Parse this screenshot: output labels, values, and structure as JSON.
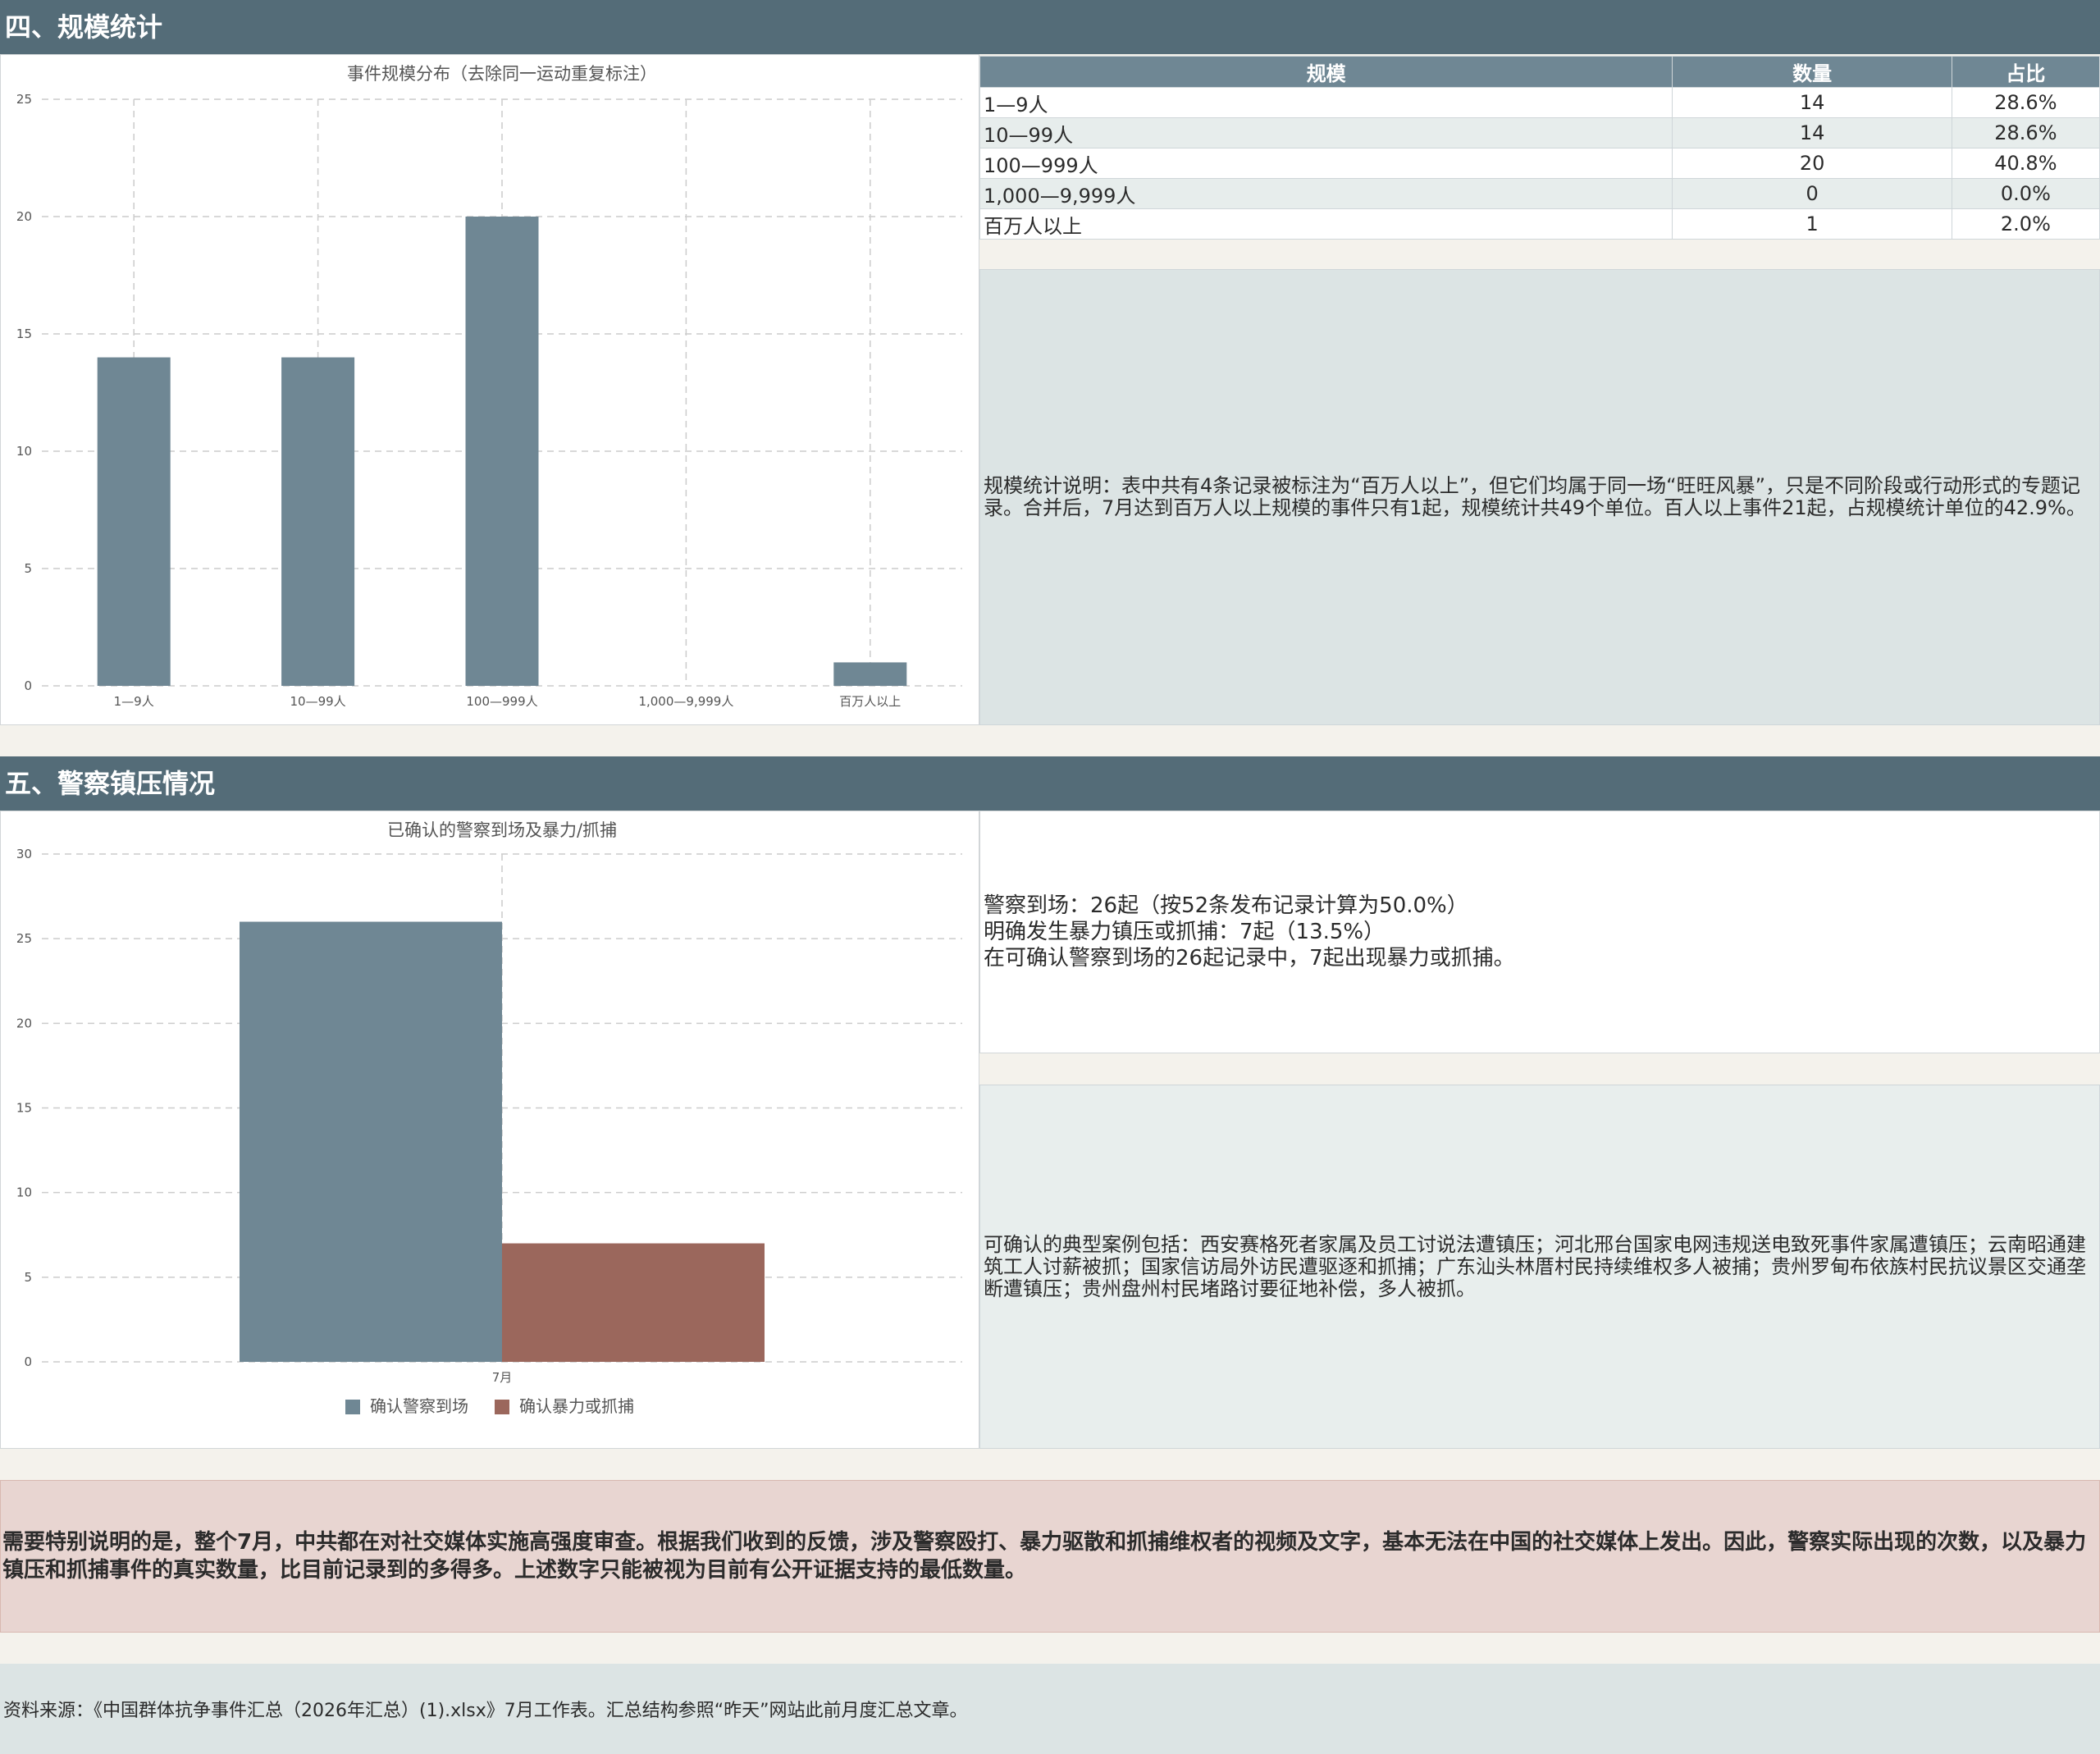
{
  "section4": {
    "title": "四、规模统计",
    "chart_title": "事件规模分布（去除同一运动重复标注）",
    "table": {
      "headers": [
        "规模",
        "数量",
        "占比"
      ],
      "rows": [
        [
          "1—9人",
          "14",
          "28.6%"
        ],
        [
          "10—99人",
          "14",
          "28.6%"
        ],
        [
          "100—999人",
          "20",
          "40.8%"
        ],
        [
          "1,000—9,999人",
          "0",
          "0.0%"
        ],
        [
          "百万人以上",
          "1",
          "2.0%"
        ]
      ]
    },
    "note": "规模统计说明：表中共有4条记录被标注为“百万人以上”，但它们均属于同一场“旺旺风暴”，只是不同阶段或行动形式的专题记录。合并后，7月达到百万人以上规模的事件只有1起，规模统计共49个单位。百人以上事件21起，占规模统计单位的42.9%。"
  },
  "section5": {
    "title": "五、警察镇压情况",
    "chart_title": "已确认的警察到场及暴力/抓捕",
    "summary_lines": [
      "警察到场：26起（按52条发布记录计算为50.0%）",
      "明确发生暴力镇压或抓捕：7起（13.5%）",
      "在可确认警察到场的26起记录中，7起出现暴力或抓捕。"
    ],
    "cases": "可确认的典型案例包括：西安赛格死者家属及员工讨说法遭镇压；河北邢台国家电网违规送电致死事件家属遭镇压；云南昭通建筑工人讨薪被抓；国家信访局外访民遭驱逐和抓捕；广东汕头林厝村民持续维权多人被捕；贵州罗甸布依族村民抗议景区交通垄断遭镇压；贵州盘州村民堵路讨要征地补偿，多人被抓。"
  },
  "warning": "需要特别说明的是，整个7月，中共都在对社交媒体实施高强度审查。根据我们收到的反馈，涉及警察殴打、暴力驱散和抓捕维权者的视频及文字，基本无法在中国的社交媒体上发出。因此，警察实际出现的次数，以及暴力镇压和抓捕事件的真实数量，比目前记录到的多得多。上述数字只能被视为目前有公开证据支持的最低数量。",
  "source": "资料来源：《中国群体抗争事件汇总（2026年汇总）(1).xlsx》7月工作表。汇总结构参照“昨天”网站此前月度汇总文章。",
  "colors": {
    "header_bg": "#546c78",
    "bar_primary": "#6f8794",
    "bar_secondary": "#9b675c",
    "note_bg": "#dce4e4",
    "warning_bg": "#e8d5d1"
  },
  "chart_data": [
    {
      "type": "bar",
      "title": "事件规模分布（去除同一运动重复标注）",
      "categories": [
        "1—9人",
        "10—99人",
        "100—999人",
        "1,000—9,999人",
        "百万人以上"
      ],
      "values": [
        14,
        14,
        20,
        0,
        1
      ],
      "ylim": [
        0,
        25
      ],
      "yticks": [
        0,
        5,
        10,
        15,
        20,
        25
      ],
      "grid": true
    },
    {
      "type": "bar",
      "title": "已确认的警察到场及暴力/抓捕",
      "categories": [
        "7月"
      ],
      "series": [
        {
          "name": "确认警察到场",
          "values": [
            26
          ]
        },
        {
          "name": "确认暴力或抓捕",
          "values": [
            7
          ]
        }
      ],
      "ylim": [
        0,
        30
      ],
      "yticks": [
        0,
        5,
        10,
        15,
        20,
        25,
        30
      ],
      "legend": "bottom",
      "grid": true
    }
  ]
}
